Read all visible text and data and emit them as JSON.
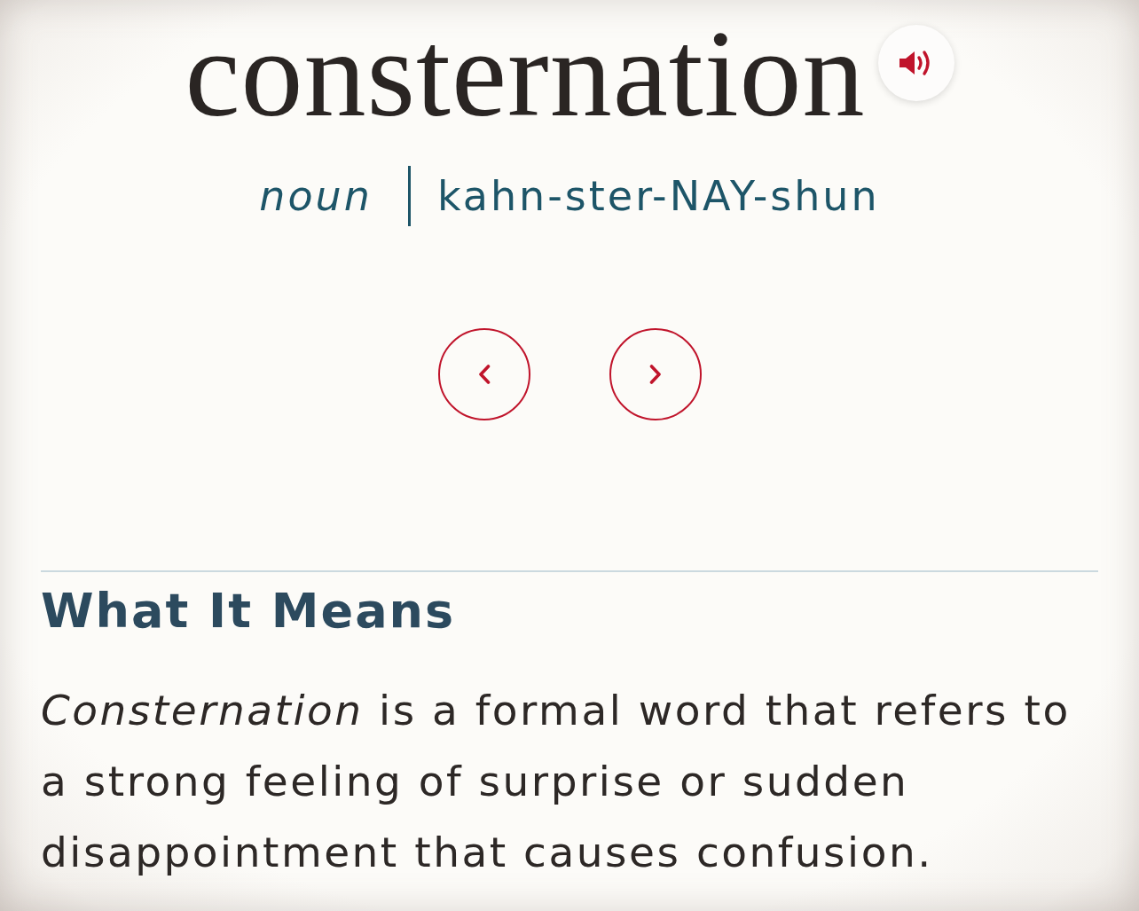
{
  "entry": {
    "headword": "consternation",
    "part_of_speech": "noun",
    "pronunciation": "kahn-ster-NAY-shun"
  },
  "section": {
    "heading": "What It Means",
    "text": "*Consternation* is a formal word that refers to a strong feeling of surprise or sudden disappointment that causes confusion."
  }
}
